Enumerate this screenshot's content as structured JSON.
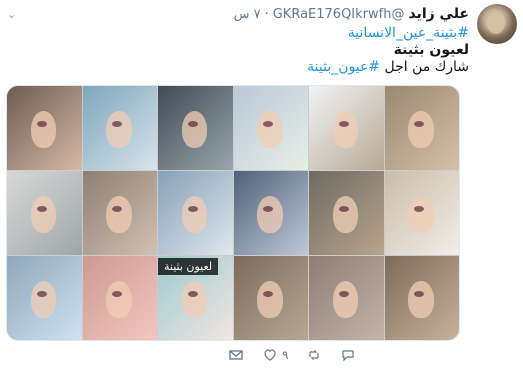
{
  "tweet": {
    "author_name": "علي زايد",
    "handle": "@GKRaE176QIkrwfh",
    "dot": "·",
    "time": "٧ س",
    "line1": "#بثينة_عين_الانسانية",
    "line2": "لعيون بثينة",
    "line3_prefix": "شارك من اجل ",
    "line3_hashtag": "#عيون_بثينة",
    "media_caption": "لعيون بثينة",
    "actions": {
      "reply_count": "",
      "retweet_count": "",
      "like_count": "٩"
    }
  },
  "icons": {
    "dropdown": "chevron-down-icon",
    "reply": "reply-icon",
    "retweet": "retweet-icon",
    "like": "heart-icon",
    "dm": "mail-icon"
  }
}
